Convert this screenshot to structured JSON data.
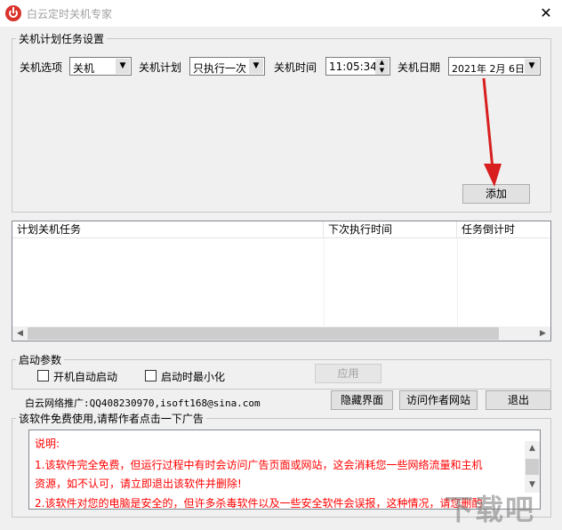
{
  "window": {
    "title": "白云定时关机专家",
    "close_glyph": "✕"
  },
  "settings": {
    "group_label": "关机计划任务设置",
    "option_label": "关机选项",
    "option_value": "关机",
    "plan_label": "关机计划",
    "plan_value": "只执行一次",
    "time_label": "关机时间",
    "time_value": "11:05:34",
    "date_label": "关机日期",
    "date_value": "2021年 2月 6日",
    "add_button": "添加"
  },
  "task_list": {
    "columns": [
      "计划关机任务",
      "下次执行时间",
      "任务倒计时"
    ],
    "rows": []
  },
  "startup": {
    "group_label": "启动参数",
    "auto_start_label": "开机自动启动",
    "auto_start_checked": false,
    "minimize_label": "启动时最小化",
    "minimize_checked": false,
    "apply_button": "应用"
  },
  "footer": {
    "promo_text": "白云网络推广:QQ408230970,isoft168@sina.com",
    "hide_button": "隐藏界面",
    "visit_button": "访问作者网站",
    "exit_button": "退出"
  },
  "notice": {
    "group_label": "该软件免费使用,请帮作者点击一下广告",
    "lines": [
      "说明:",
      "1.该软件完全免费，但运行过程中有时会访问广告页面或网站，这会消耗您一些网络流量和主机",
      "资源，如不认可，请立即退出该软件并删除!",
      "2.该软件对您的电脑是安全的，但许多杀毒软件以及一些安全软件会误报，这种情况，请您删酌"
    ]
  },
  "watermark": "下载吧",
  "colors": {
    "notice_text": "#ff0000",
    "annotation_arrow": "#d81e1e",
    "app_icon": "#d9322b"
  }
}
